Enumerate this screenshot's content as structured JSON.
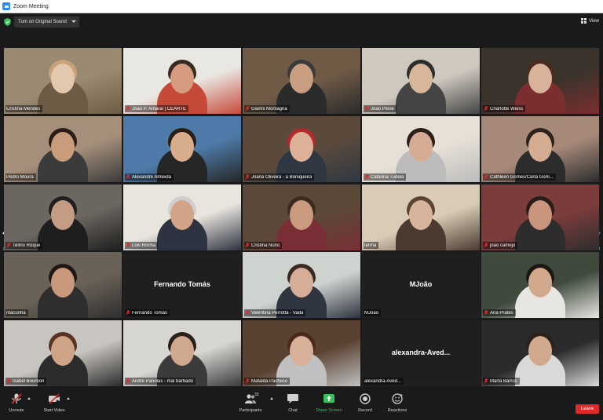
{
  "window": {
    "title": "Zoom Meeting"
  },
  "topbar": {
    "sound_button": "Turn on Original Sound",
    "view_label": "View"
  },
  "colors": {
    "accent": "#2d8cff",
    "active_speaker": "#f3e86b",
    "muted_icon": "#e02828",
    "leave": "#e02828",
    "share": "#3bbf5d"
  },
  "pager": {
    "left_page": "1/2",
    "right_page": "1/2"
  },
  "tiles": [
    {
      "name": "Cristina Mendes",
      "muted": false,
      "video": true
    },
    {
      "name": "João P. Amaral | CEARTE",
      "muted": true,
      "video": true
    },
    {
      "name": "Gianni Montagna",
      "muted": true,
      "video": true
    },
    {
      "name": "João Peixe",
      "muted": true,
      "video": true
    },
    {
      "name": "Charlotte Weiss",
      "muted": true,
      "video": true
    },
    {
      "name": "Pedro Moura",
      "muted": false,
      "video": true
    },
    {
      "name": "Alexandre Almeida",
      "muted": true,
      "video": true
    },
    {
      "name": "Joana Oliveira - a Boniqueira",
      "muted": true,
      "video": true
    },
    {
      "name": "Catarina Tudela",
      "muted": true,
      "video": true
    },
    {
      "name": "Cathleen Gomes/Carla Gom...",
      "muted": true,
      "video": true
    },
    {
      "name": "Telmo Roque",
      "muted": true,
      "video": true
    },
    {
      "name": "Luis Rocha",
      "muted": true,
      "video": true
    },
    {
      "name": "Cristina Nuno",
      "muted": true,
      "video": true
    },
    {
      "name": "terma",
      "muted": false,
      "video": true
    },
    {
      "name": "joao camejo",
      "muted": true,
      "video": true
    },
    {
      "name": "ritacunha",
      "muted": false,
      "video": true
    },
    {
      "name": "Fernando Tomás",
      "muted": true,
      "video": false
    },
    {
      "name": "Valentina Perrotta - Vada",
      "muted": true,
      "video": true
    },
    {
      "name": "MJoão",
      "muted": false,
      "video": false
    },
    {
      "name": "Ana Prates",
      "muted": true,
      "video": true
    },
    {
      "name": "Isabel Bourbon",
      "muted": true,
      "video": true
    },
    {
      "name": "André Pariolas - mal barbado",
      "muted": true,
      "video": true
    },
    {
      "name": "Mafalda Pacheco",
      "muted": true,
      "video": true
    },
    {
      "name": "alexandra-Aved...",
      "muted": false,
      "video": false
    },
    {
      "name": "Marta Barros",
      "muted": true,
      "video": true
    }
  ],
  "active_speaker_index": 15,
  "toolbar": {
    "unmute": "Unmute",
    "start_video": "Start Video",
    "participants": "Participants",
    "participants_count": "33",
    "chat": "Chat",
    "share_screen": "Share Screen",
    "record": "Record",
    "reactions": "Reactions",
    "leave": "Leave"
  }
}
